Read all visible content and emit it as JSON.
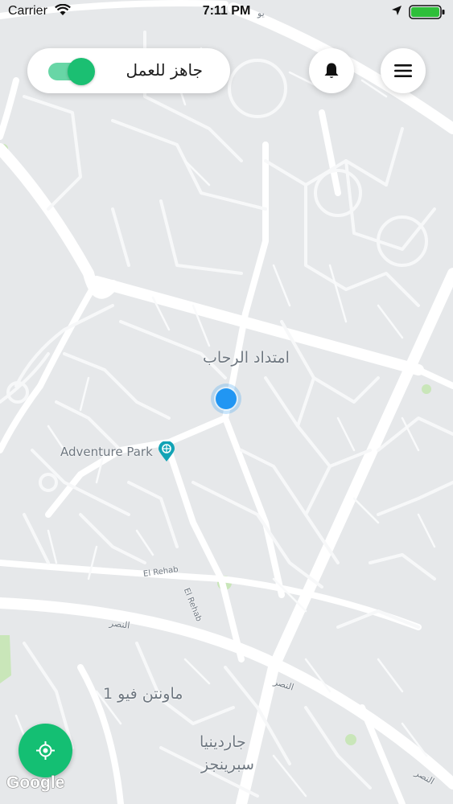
{
  "status_bar": {
    "carrier": "Carrier",
    "time": "7:11 PM",
    "icons": [
      "wifi-icon",
      "location-arrow-icon",
      "battery-icon"
    ],
    "battery_color": "#2fbf3a"
  },
  "header": {
    "availability_label": "جاهز للعمل",
    "availability_on": true,
    "toggle_color": "#1bbf72",
    "bell_icon": "bell-icon",
    "menu_icon": "hamburger-menu-icon"
  },
  "map": {
    "labels": {
      "rehab_extension": "امتداد الرحاب",
      "adventure_park": "Adventure Park",
      "el_rehab_1": "El Rehab",
      "el_rehab_2": "El Rehab",
      "nasr_1": "النصر",
      "nasr_2": "النصر",
      "nasr_3": "النصر",
      "mountain_view": "ماونتن فيو 1",
      "garden_1": "جاردينيا",
      "garden_2": "سبرينجز"
    },
    "park_icon": "park-pin-icon",
    "user_location_color": "#2196f3",
    "attribution": "Google"
  },
  "locate_button": {
    "icon": "crosshair-icon",
    "color": "#14bf73"
  }
}
